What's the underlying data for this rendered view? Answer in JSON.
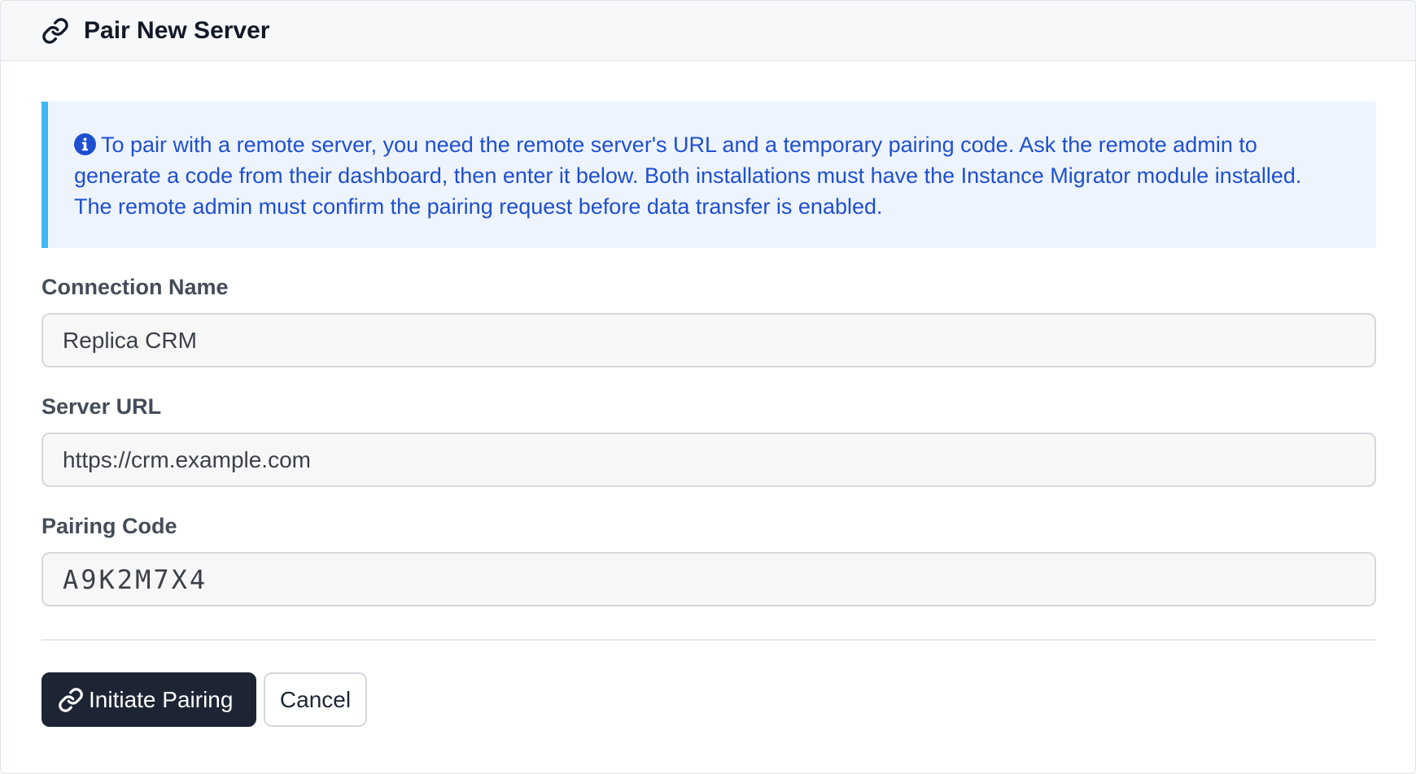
{
  "header": {
    "icon": "link-icon",
    "title": "Pair New Server"
  },
  "alert": {
    "icon": "info-circle-icon",
    "text": "To pair with a remote server, you need the remote server's URL and a temporary pairing code. Ask the remote admin to generate a code from their dashboard, then enter it below. Both installations must have the Instance Migrator module installed. The remote admin must confirm the pairing request before data transfer is enabled.",
    "color": "#1f4fd1",
    "accent": "#3fb8f3",
    "background": "#edf4fd"
  },
  "form": {
    "connection_name": {
      "label": "Connection Name",
      "value": "Replica CRM"
    },
    "server_url": {
      "label": "Server URL",
      "value": "https://crm.example.com"
    },
    "pairing_code": {
      "label": "Pairing Code",
      "value": "A9K2M7X4"
    }
  },
  "actions": {
    "primary_icon": "link-icon",
    "primary_label": "Initiate Pairing",
    "secondary_label": "Cancel",
    "primary_color": "#1d2534"
  }
}
